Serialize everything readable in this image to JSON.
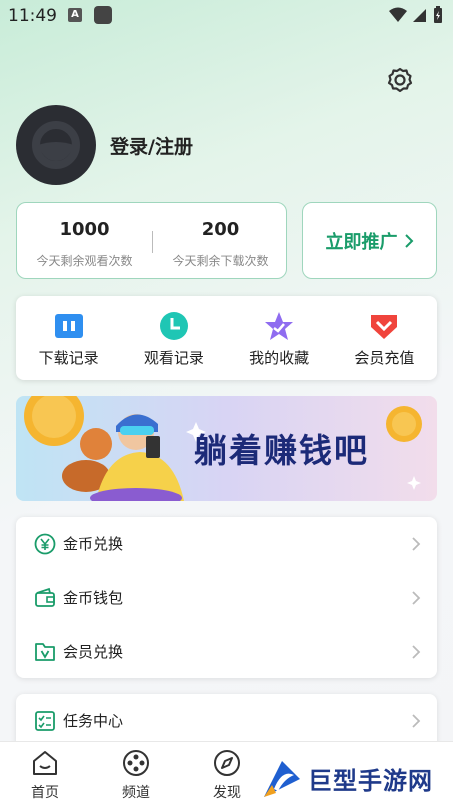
{
  "status_bar": {
    "time": "11:49",
    "notif_letter": "A"
  },
  "profile": {
    "login_label": "登录/注册"
  },
  "stats": [
    {
      "value": "1000",
      "label": "今天剩余观看次数"
    },
    {
      "value": "200",
      "label": "今天剩余下载次数"
    }
  ],
  "promote": {
    "label": "立即推广"
  },
  "quick_actions": [
    {
      "label": "下载记录",
      "icon": "download-record-icon",
      "color": "#2f8ff0"
    },
    {
      "label": "观看记录",
      "icon": "clock-icon",
      "color": "#1fc6b4"
    },
    {
      "label": "我的收藏",
      "icon": "star-icon",
      "color": "#8f6cf0"
    },
    {
      "label": "会员充值",
      "icon": "vip-gem-icon",
      "color": "#f0443c"
    }
  ],
  "banner": {
    "text": "躺着赚钱吧"
  },
  "menu": [
    {
      "label": "金币兑换",
      "icon": "yen-coin-icon"
    },
    {
      "label": "金币钱包",
      "icon": "wallet-icon"
    },
    {
      "label": "会员兑换",
      "icon": "vip-folder-icon"
    }
  ],
  "task": {
    "label": "任务中心",
    "icon": "task-list-icon"
  },
  "bottom_nav": [
    {
      "label": "首页",
      "icon": "home-icon"
    },
    {
      "label": "频道",
      "icon": "film-reel-icon"
    },
    {
      "label": "发现",
      "icon": "compass-icon"
    }
  ],
  "watermark": {
    "text": "巨型手游网"
  },
  "colors": {
    "accent": "#1a9c6a",
    "border": "#9fd6bd"
  }
}
